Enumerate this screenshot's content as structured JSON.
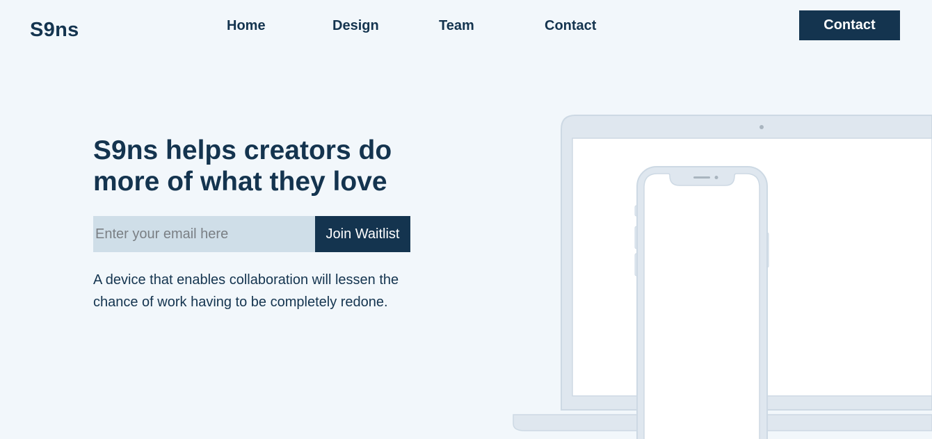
{
  "brand": {
    "logo": "S9ns"
  },
  "nav": {
    "items": [
      {
        "label": "Home"
      },
      {
        "label": "Design"
      },
      {
        "label": "Team"
      },
      {
        "label": "Contact"
      }
    ],
    "cta_label": "Contact"
  },
  "hero": {
    "title": "S9ns helps creators do more of what they love",
    "email_placeholder": "Enter your email here",
    "email_value": "",
    "join_label": "Join Waitlist",
    "description": "A device that enables collaboration will lessen the chance of work having to be completely redone."
  },
  "colors": {
    "page_background": "#f2f7fb",
    "primary": "#14344f",
    "input_background": "#cfdee8",
    "device_frame": "#dfe7ef"
  },
  "illustration": {
    "icons": [
      "laptop-icon",
      "phone-icon"
    ]
  }
}
